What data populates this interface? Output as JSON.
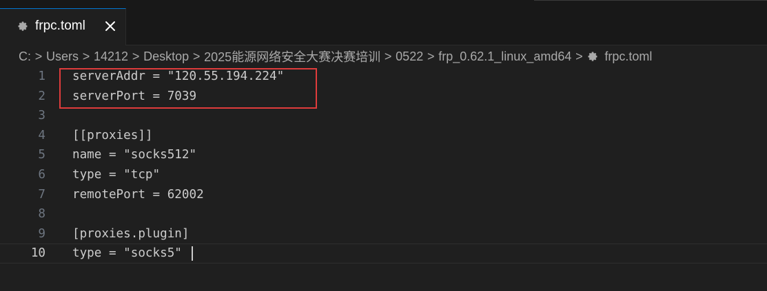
{
  "tab": {
    "label": "frpc.toml",
    "icon": "gear-icon",
    "close_icon": "close-icon"
  },
  "breadcrumb": {
    "items": [
      "C:",
      "Users",
      "14212",
      "Desktop",
      "2025能源网络安全大赛决赛培训",
      "0522",
      "frp_0.62.1_linux_amd64"
    ],
    "file": "frpc.toml",
    "separator": ">"
  },
  "editor": {
    "current_line": 10,
    "lines": [
      {
        "number": "1",
        "text": "serverAddr = \"120.55.194.224\""
      },
      {
        "number": "2",
        "text": "serverPort = 7039"
      },
      {
        "number": "3",
        "text": ""
      },
      {
        "number": "4",
        "text": "[[proxies]]"
      },
      {
        "number": "5",
        "text": "name = \"socks512\""
      },
      {
        "number": "6",
        "text": "type = \"tcp\""
      },
      {
        "number": "7",
        "text": "remotePort = 62002"
      },
      {
        "number": "8",
        "text": ""
      },
      {
        "number": "9",
        "text": "[proxies.plugin]"
      },
      {
        "number": "10",
        "text": "type = \"socks5\""
      }
    ]
  },
  "colors": {
    "background": "#1f1f1f",
    "tabbar": "#181818",
    "text": "#cccccc",
    "line_number": "#6e7681",
    "highlight_box": "#e03c3c",
    "active_tab_border": "#0078d4"
  }
}
